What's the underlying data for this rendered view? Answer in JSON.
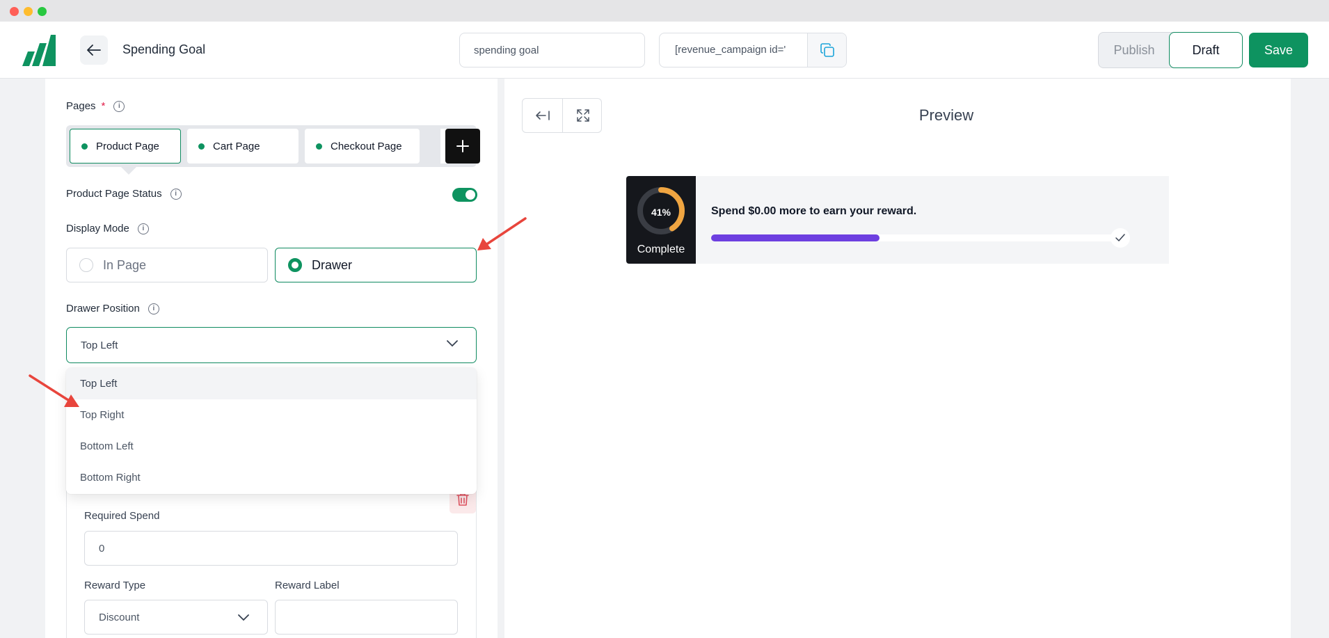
{
  "window": {
    "controls": {
      "close_color": "#ff5f57",
      "minimize_color": "#febc2e",
      "maximize_color": "#28c840"
    }
  },
  "header": {
    "title": "Spending Goal",
    "campaign_name": "spending goal",
    "shortcode": "[revenue_campaign id='",
    "publish_label": "Publish",
    "draft_label": "Draft",
    "save_label": "Save"
  },
  "form": {
    "pages_label": "Pages",
    "pages_required_mark": "*",
    "pages": [
      {
        "label": "Product Page"
      },
      {
        "label": "Cart Page"
      },
      {
        "label": "Checkout Page"
      }
    ],
    "status_label": "Product Page Status",
    "status_on": true,
    "display_mode_label": "Display Mode",
    "display_modes": [
      {
        "label": "In Page",
        "selected": false
      },
      {
        "label": "Drawer",
        "selected": true
      }
    ],
    "drawer_position_label": "Drawer Position",
    "drawer_position_value": "Top Left",
    "drawer_position_options": [
      "Top Left",
      "Top Right",
      "Bottom Left",
      "Bottom Right"
    ],
    "required_spend_label": "Required Spend",
    "required_spend_value": "0",
    "reward_type_label": "Reward Type",
    "reward_type_value": "Discount",
    "reward_label_label": "Reward Label",
    "reward_label_value": ""
  },
  "preview": {
    "title": "Preview",
    "percent_label": "41%",
    "progress_fraction": 0.41,
    "complete_label": "Complete",
    "message": "Spend $0.00 more to earn your reward.",
    "progress_color": "#6d3fe0",
    "ring_color": "#f0a541"
  },
  "colors": {
    "accent": "#0e9360",
    "annotation_arrow": "#e8453c"
  }
}
